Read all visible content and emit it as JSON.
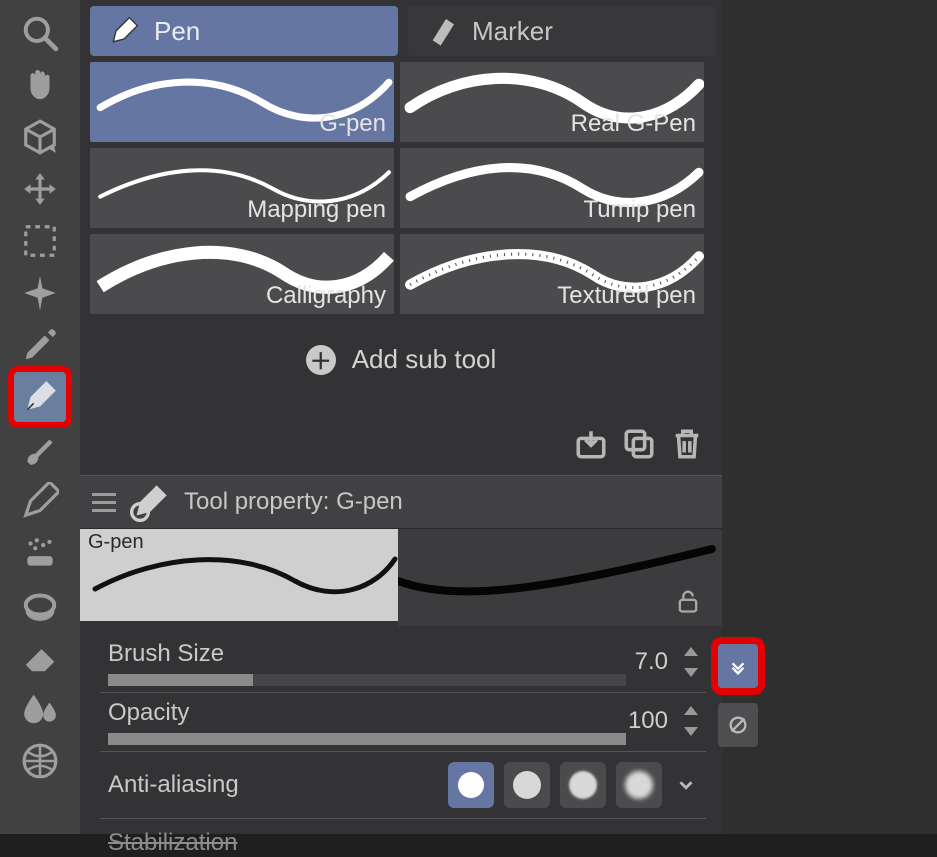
{
  "toolbar": {
    "tools": [
      "magnifier",
      "pan-hand",
      "object-3d",
      "move-arrows",
      "marquee",
      "sparkle",
      "eyedropper",
      "pen",
      "brush",
      "pencil",
      "airbrush",
      "fill-bucket",
      "eraser",
      "blend",
      "mesh-transform"
    ],
    "selected_tool": "pen",
    "highlighted_tool": "pen"
  },
  "tabs": {
    "items": [
      {
        "label": "Pen",
        "active": true
      },
      {
        "label": "Marker",
        "active": false
      }
    ]
  },
  "subtools": {
    "items": [
      {
        "label": "G-pen",
        "selected": true
      },
      {
        "label": "Real G-Pen",
        "selected": false
      },
      {
        "label": "Mapping pen",
        "selected": false
      },
      {
        "label": "Tumip pen",
        "selected": false
      },
      {
        "label": "Calligraphy",
        "selected": false
      },
      {
        "label": "Textured pen",
        "selected": false
      }
    ],
    "add_label": "Add sub tool"
  },
  "actions": {
    "import": "import-icon",
    "duplicate": "duplicate-icon",
    "delete": "trash-icon"
  },
  "property_panel": {
    "title": "Tool property: G-pen",
    "preview_label": "G-pen",
    "brush_size": {
      "label": "Brush Size",
      "value": "7.0",
      "fill_percent": 28,
      "dynamics_highlighted": true
    },
    "opacity": {
      "label": "Opacity",
      "value": "100",
      "fill_percent": 100
    },
    "anti_aliasing": {
      "label": "Anti-aliasing",
      "selected_index": 0,
      "option_count": 4
    },
    "stabilization": {
      "label": "Stabilization"
    }
  }
}
